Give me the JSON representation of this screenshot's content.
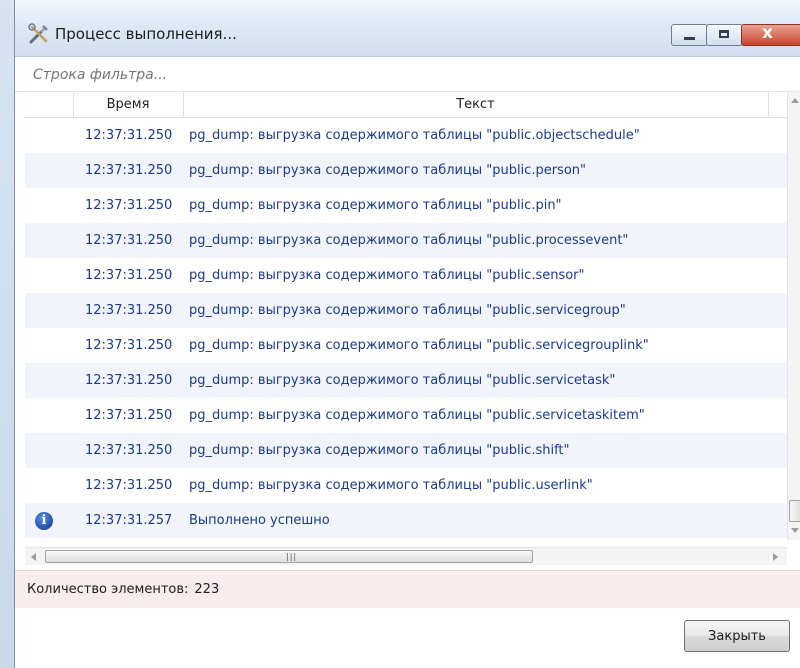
{
  "window": {
    "title": "Процесс выполнения...",
    "title_icon": "tools-icon",
    "buttons": [
      {
        "name": "minimize",
        "icon": "minimize-icon"
      },
      {
        "name": "maximize",
        "icon": "maximize-icon"
      },
      {
        "name": "close",
        "label": "x",
        "icon": "close-icon"
      }
    ]
  },
  "filter": {
    "placeholder": "Строка фильтра..."
  },
  "grid": {
    "columns": [
      "Время",
      "Текст"
    ],
    "rows": [
      {
        "time": "12:37:31.250",
        "text": "pg_dump: выгрузка содержимого таблицы \"public.objectschedule\""
      },
      {
        "time": "12:37:31.250",
        "text": "pg_dump: выгрузка содержимого таблицы \"public.person\""
      },
      {
        "time": "12:37:31.250",
        "text": "pg_dump: выгрузка содержимого таблицы \"public.pin\""
      },
      {
        "time": "12:37:31.250",
        "text": "pg_dump: выгрузка содержимого таблицы \"public.processevent\""
      },
      {
        "time": "12:37:31.250",
        "text": "pg_dump: выгрузка содержимого таблицы \"public.sensor\""
      },
      {
        "time": "12:37:31.250",
        "text": "pg_dump: выгрузка содержимого таблицы \"public.servicegroup\""
      },
      {
        "time": "12:37:31.250",
        "text": "pg_dump: выгрузка содержимого таблицы \"public.servicegrouplink\""
      },
      {
        "time": "12:37:31.250",
        "text": "pg_dump: выгрузка содержимого таблицы \"public.servicetask\""
      },
      {
        "time": "12:37:31.250",
        "text": "pg_dump: выгрузка содержимого таблицы \"public.servicetaskitem\""
      },
      {
        "time": "12:37:31.250",
        "text": "pg_dump: выгрузка содержимого таблицы \"public.shift\""
      },
      {
        "time": "12:37:31.250",
        "text": "pg_dump: выгрузка содержимого таблицы \"public.userlink\""
      },
      {
        "time": "12:37:31.257",
        "text": "Выполнено успешно",
        "icon": "info-icon"
      }
    ]
  },
  "status": {
    "label": "Количество элементов:",
    "count": "223"
  },
  "footer": {
    "close_label": "Закрыть"
  },
  "colors": {
    "row_text": "#1a3a8a",
    "row_alt_bg": "#f1f4fb",
    "status_bg": "#f8ecec",
    "close_button_red": "#c9452c"
  }
}
